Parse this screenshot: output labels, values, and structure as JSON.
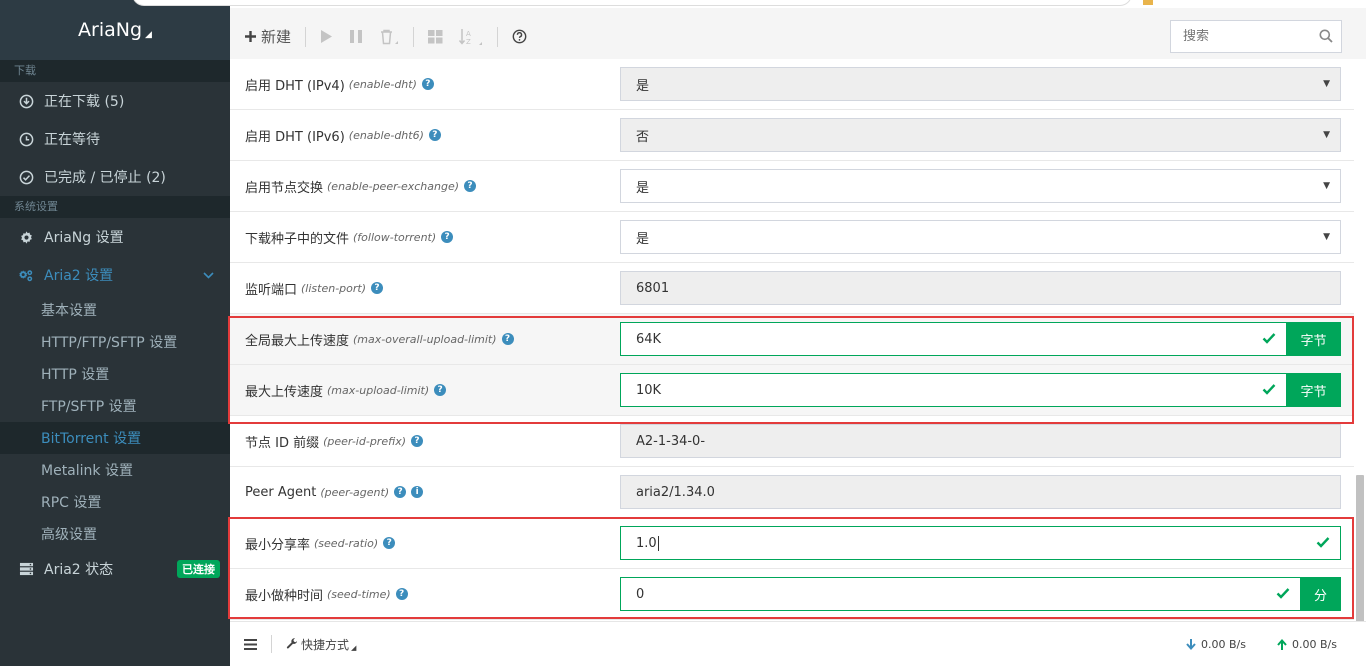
{
  "app": {
    "title": "AriaNg"
  },
  "sidebar": {
    "download_section": "下载",
    "downloads": [
      {
        "label": "正在下载 (5)",
        "icon": "download-circle-icon"
      },
      {
        "label": "正在等待",
        "icon": "clock-icon"
      },
      {
        "label": "已完成 / 已停止 (2)",
        "icon": "check-circle-icon"
      }
    ],
    "settings_section": "系统设置",
    "ariang_settings": "AriaNg 设置",
    "aria2_settings": "Aria2 设置",
    "aria2_sub": [
      "基本设置",
      "HTTP/FTP/SFTP 设置",
      "HTTP 设置",
      "FTP/SFTP 设置",
      "BitTorrent 设置",
      "Metalink 设置",
      "RPC 设置",
      "高级设置"
    ],
    "aria2_status": "Aria2 状态",
    "connected_badge": "已连接"
  },
  "toolbar": {
    "new_label": "新建",
    "search_placeholder": "搜索"
  },
  "settings": [
    {
      "label": "启用 DHT (IPv4)",
      "key": "(enable-dht)",
      "value": "是",
      "type": "select",
      "readonly": true
    },
    {
      "label": "启用 DHT (IPv6)",
      "key": "(enable-dht6)",
      "value": "否",
      "type": "select",
      "readonly": true
    },
    {
      "label": "启用节点交换",
      "key": "(enable-peer-exchange)",
      "value": "是",
      "type": "select",
      "readonly": false
    },
    {
      "label": "下载种子中的文件",
      "key": "(follow-torrent)",
      "value": "是",
      "type": "select",
      "readonly": false
    },
    {
      "label": "监听端口",
      "key": "(listen-port)",
      "value": "6801",
      "type": "text",
      "readonly": true
    },
    {
      "label": "全局最大上传速度",
      "key": "(max-overall-upload-limit)",
      "value": "64K",
      "type": "text",
      "success": true,
      "unit": "字节"
    },
    {
      "label": "最大上传速度",
      "key": "(max-upload-limit)",
      "value": "10K",
      "type": "text",
      "success": true,
      "unit": "字节"
    },
    {
      "label": "节点 ID 前缀",
      "key": "(peer-id-prefix)",
      "value": "A2-1-34-0-",
      "type": "text",
      "readonly": true
    },
    {
      "label": "Peer Agent",
      "key": "(peer-agent)",
      "value": "aria2/1.34.0",
      "type": "text",
      "readonly": true,
      "info": true
    },
    {
      "label": "最小分享率",
      "key": "(seed-ratio)",
      "value": "1.0",
      "type": "text",
      "success": true
    },
    {
      "label": "最小做种时间",
      "key": "(seed-time)",
      "value": "0",
      "type": "text",
      "success": true,
      "unit": "分"
    }
  ],
  "footer": {
    "shortcuts": "快捷方式",
    "download_speed": "0.00 B/s",
    "upload_speed": "0.00 B/s"
  },
  "colors": {
    "accent": "#3c8dbc",
    "success": "#00a65a",
    "highlight": "#e33b3b",
    "sidebar_bg": "#2a3338"
  }
}
